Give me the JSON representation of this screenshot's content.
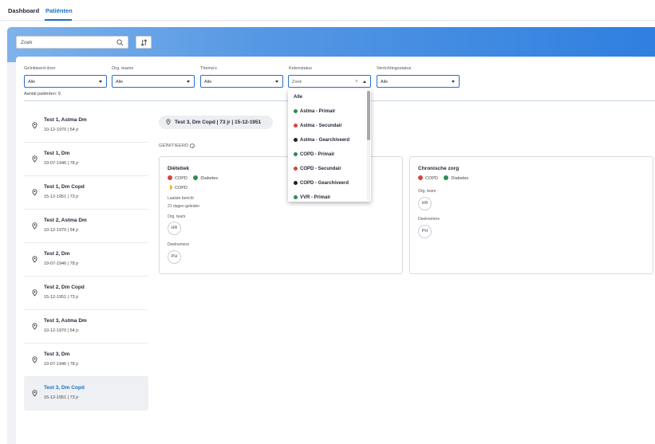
{
  "nav": {
    "tabs": [
      {
        "label": "Dashboard"
      },
      {
        "label": "Patiënten"
      }
    ]
  },
  "search": {
    "placeholder": "Zoek"
  },
  "filters": [
    {
      "label": "Geïnitieerd door",
      "value": "Alle"
    },
    {
      "label": "Org. teams",
      "value": "Alle"
    },
    {
      "label": "Thema's",
      "value": "Alle"
    },
    {
      "label": "Ketenstatus",
      "value": "Zoek"
    },
    {
      "label": "Verrichtingsstatus",
      "value": "Alle"
    }
  ],
  "count_label": "Aantal patiënten: 9",
  "patients": [
    {
      "name": "Test 1, Astma Dm",
      "meta": "10-12-1970 | 54 jr"
    },
    {
      "name": "Test 1, Dm",
      "meta": "19-07-1946 | 78 jr"
    },
    {
      "name": "Test 1, Dm Copd",
      "meta": "15-12-1951 | 73 jr"
    },
    {
      "name": "Test 2, Astma Dm",
      "meta": "10-12-1970 | 54 jr"
    },
    {
      "name": "Test 2, Dm",
      "meta": "19-07-1946 | 78 jr"
    },
    {
      "name": "Test 2, Dm Copd",
      "meta": "15-12-1951 | 73 jr"
    },
    {
      "name": "Test 3, Astma Dm",
      "meta": "10-12-1970 | 54 jr"
    },
    {
      "name": "Test 3, Dm",
      "meta": "19-07-1946 | 78 jr"
    },
    {
      "name": "Test 3, Dm Copd",
      "meta": "15-12-1951 | 73 jr"
    }
  ],
  "selected_patient": "Test 3, Dm Copd | 73 jr | 15-12-1951",
  "section_label": "GEÏNITIEERD",
  "cards": [
    {
      "title": "Diëtetiek",
      "tags1": [
        "COPD",
        "Diabetes"
      ],
      "tags2": [
        "COPD"
      ],
      "last_msg_label": "Laatste bericht",
      "last_msg_value": "21 dagen geleden",
      "org_team_label": "Org. team",
      "org_team_value": "HR",
      "members_label": "Deelnemers",
      "members_value": "PH"
    },
    {
      "title": "Chronische zorg",
      "tags1": [
        "COPD",
        "Diabetes"
      ],
      "org_team_label": "Org. team",
      "org_team_value": "HR",
      "members_label": "Deelnemers",
      "members_value": "PH"
    }
  ],
  "dropdown": {
    "items": [
      {
        "label": "Alle",
        "color": ""
      },
      {
        "label": "Astma - Primair",
        "color": "#2e8b57"
      },
      {
        "label": "Astma - Secundair",
        "color": "#d64545"
      },
      {
        "label": "Astma - Gearchiveerd",
        "color": "#222222"
      },
      {
        "label": "COPD - Primair",
        "color": "#2e8b57"
      },
      {
        "label": "COPD - Secundair",
        "color": "#d64545"
      },
      {
        "label": "COPD - Gearchiveerd",
        "color": "#222222"
      },
      {
        "label": "VVR - Primair",
        "color": "#2e8b57"
      }
    ]
  },
  "colors": {
    "accent": "#1a6fc4",
    "red": "#d64545",
    "green": "#2e8b57",
    "yellow": "#f0b429"
  },
  "icons": {
    "search": "search-icon",
    "sort": "sort-icon",
    "pin": "location-pin-icon",
    "info": "info-icon"
  }
}
